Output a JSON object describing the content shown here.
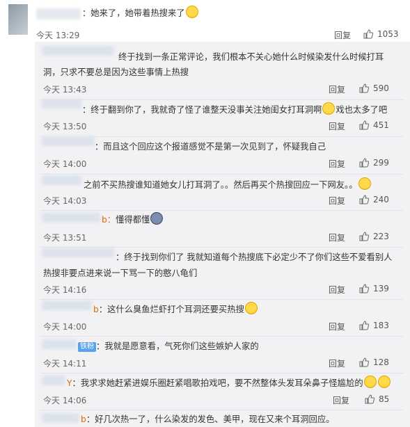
{
  "comments": [
    {
      "text": "：她来了，她带着热搜来了",
      "time": "今天 13:29",
      "reply": "回复",
      "likes": "1053"
    }
  ],
  "replies": [
    {
      "line1": "终于找到一条正常评论，我们根本不关心她什么时候染发什么时候打耳",
      "line2": "洞，只求不要总是因为这些事情上热搜",
      "time": "今天 13:43",
      "reply": "回复",
      "likes": "590"
    },
    {
      "line1": "：终于翻到你了，我就奇了怪了谁整天没事关注她闺女打耳洞啊",
      "line1b": "戏也太多了吧",
      "time": "今天 13:50",
      "reply": "回复",
      "likes": "451"
    },
    {
      "line1": "：而且这个回应这个报道感觉不是第一次见到了，怀疑我自己",
      "time": "今天 14:00",
      "reply": "回复",
      "likes": "299"
    },
    {
      "line1": "之前不买热搜谁知道她女儿打耳洞了。。然后再买个热搜回应一下网友。。",
      "time": "今天 14:03",
      "reply": "回复",
      "likes": "240"
    },
    {
      "line1": "懂得都懂",
      "prefix": "b：",
      "time": "今天 13:51",
      "reply": "回复",
      "likes": "223"
    },
    {
      "line1": "：终于找到你们了 我就知道每个热搜底下必定少不了你们这些不爱看别人",
      "line2": "热搜非要点进来说一下骂一下的憨八龟们",
      "time": "今天 14:16",
      "reply": "回复",
      "likes": "139"
    },
    {
      "line1": "：这什么臭鱼烂虾打个耳洞还要买热搜",
      "prefix": "b",
      "time": "今天 14:00",
      "reply": "回复",
      "likes": "183"
    },
    {
      "line1": "：我就是愿意看，气死你们这些嫉妒人家的",
      "badge": "铁粉",
      "time": "今天 14:11",
      "reply": "回复",
      "likes": "128"
    },
    {
      "line1": "：我求求她赶紧进娱乐圈赶紧唱歌拍戏吧，要不然整体头发耳朵鼻子怪尴尬的",
      "prefix": "Y",
      "time": "今天 14:06",
      "reply": "回复",
      "likes": "85"
    },
    {
      "line1": "：好几次热一了，什么染发的发色、美甲，现在又来个耳洞回应。",
      "prefix": "b"
    }
  ]
}
